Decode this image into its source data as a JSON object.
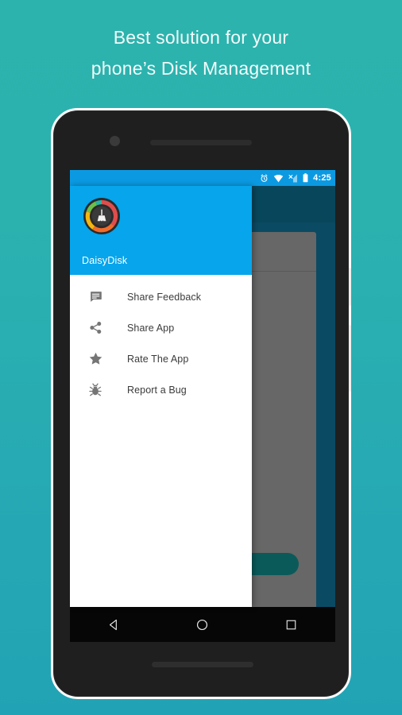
{
  "promo": {
    "line1": "Best solution for your",
    "line2": "phone’s Disk Management",
    "text_color": "#f2fbfa",
    "background_gradient": [
      "#2cb3ad",
      "#22a3b5"
    ]
  },
  "device": {
    "frame_color": "#1f1f1f",
    "outline_color": "#ffffff",
    "camera": "front-camera",
    "earpiece": "earpiece-speaker",
    "bottom_speaker": "bottom-speaker",
    "side_buttons": [
      "power-button",
      "volume-button"
    ]
  },
  "status_bar": {
    "background": "#0b9ae2",
    "time": "4:25",
    "icons": [
      "alarm-icon",
      "wifi-icon",
      "signal-off-icon",
      "battery-icon"
    ]
  },
  "drawer": {
    "header": {
      "background": "#06a5ec",
      "app_name": "DaisyDisk",
      "logo": {
        "name": "daisydisk-logo",
        "ring_colors": [
          "#e04d4d",
          "#ef6b2c",
          "#f3b711",
          "#6cc04a",
          "#25b5a5"
        ],
        "center_color": "#333333",
        "glyph": "broom-icon"
      }
    },
    "items": [
      {
        "icon": "chat-bubble-icon",
        "label": "Share Feedback"
      },
      {
        "icon": "share-icon",
        "label": "Share App"
      },
      {
        "icon": "star-icon",
        "label": "Rate The App"
      },
      {
        "icon": "bug-icon",
        "label": "Report a Bug"
      }
    ]
  },
  "background_activity": {
    "toolbar_color": "#08465c",
    "card_color": "#666766",
    "progress_ring_color": "#8a5a10",
    "action_button_color": "#0b5a5a"
  },
  "navigation_bar": {
    "background": "#060606",
    "buttons": [
      "back-button",
      "home-button",
      "recents-button"
    ]
  }
}
